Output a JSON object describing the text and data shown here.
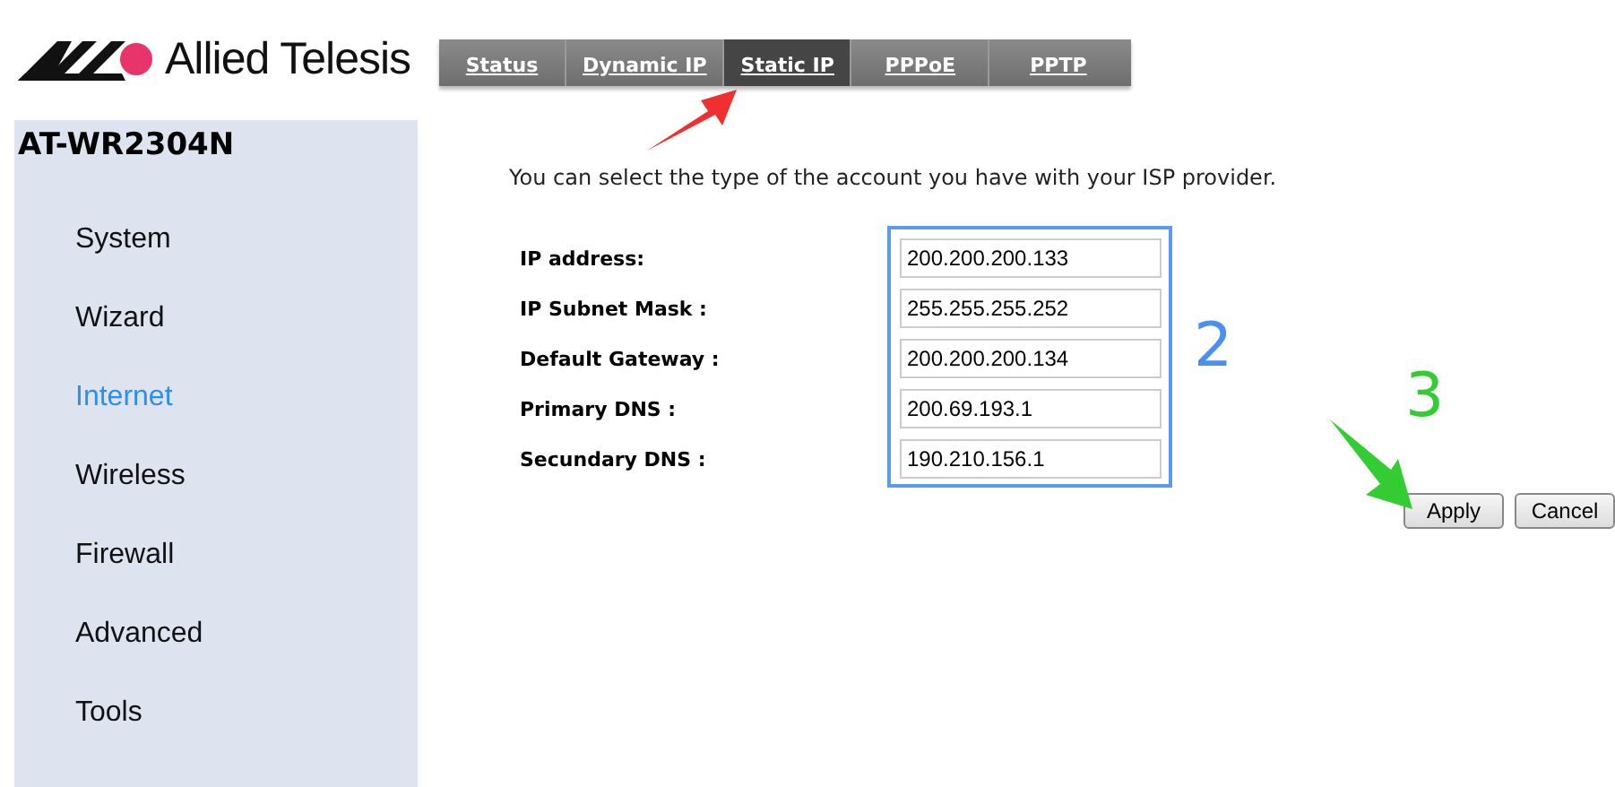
{
  "logo": {
    "text": "Allied Telesis"
  },
  "device": {
    "model": "AT-WR2304N"
  },
  "sidebar": {
    "items": [
      {
        "label": "System",
        "selected": false
      },
      {
        "label": "Wizard",
        "selected": false
      },
      {
        "label": "Internet",
        "selected": true
      },
      {
        "label": "Wireless",
        "selected": false
      },
      {
        "label": "Firewall",
        "selected": false
      },
      {
        "label": "Advanced",
        "selected": false
      },
      {
        "label": "Tools",
        "selected": false
      }
    ]
  },
  "tabs": [
    {
      "label": "Status",
      "selected": false
    },
    {
      "label": "Dynamic IP",
      "selected": false
    },
    {
      "label": "Static IP",
      "selected": true
    },
    {
      "label": "PPPoE",
      "selected": false
    },
    {
      "label": "PPTP",
      "selected": false
    }
  ],
  "intro": "You can select the type of the account you have with your ISP provider.",
  "form": {
    "fields": [
      {
        "label": "IP address:",
        "value": "200.200.200.133"
      },
      {
        "label": "IP Subnet Mask :",
        "value": "255.255.255.252"
      },
      {
        "label": "Default Gateway :",
        "value": "200.200.200.134"
      },
      {
        "label": "Primary DNS :",
        "value": "200.69.193.1"
      },
      {
        "label": "Secundary DNS :",
        "value": "190.210.156.1"
      }
    ]
  },
  "buttons": [
    {
      "label": "Apply"
    },
    {
      "label": "Cancel"
    }
  ],
  "annotations": [
    {
      "kind": "arrow",
      "color": "#f03030"
    },
    {
      "kind": "number",
      "text": "2",
      "color": "#4a90f0"
    },
    {
      "kind": "number",
      "text": "3",
      "color": "#33cc33"
    },
    {
      "kind": "arrow",
      "color": "#33cc33"
    }
  ]
}
